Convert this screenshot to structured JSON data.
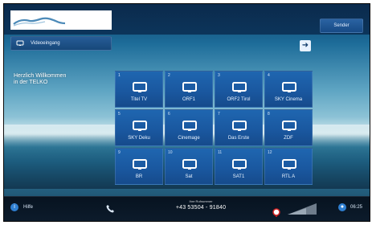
{
  "top_bar": {
    "button_label": "Sender"
  },
  "input_bar": {
    "label": "Videoeingang"
  },
  "welcome": {
    "line1": "Herzlich Willkommen",
    "line2": "in der TELKO"
  },
  "channels": [
    {
      "number": "1",
      "name": "Titel TV"
    },
    {
      "number": "2",
      "name": "ORF1"
    },
    {
      "number": "3",
      "name": "ORF2 Tirol"
    },
    {
      "number": "4",
      "name": "SKY Cinema"
    },
    {
      "number": "5",
      "name": "SKY Deku"
    },
    {
      "number": "6",
      "name": "Cinemage"
    },
    {
      "number": "7",
      "name": "Das Erste"
    },
    {
      "number": "8",
      "name": "ZDF"
    },
    {
      "number": "9",
      "name": "BR"
    },
    {
      "number": "10",
      "name": "Sat"
    },
    {
      "number": "11",
      "name": "SAT1"
    },
    {
      "number": "12",
      "name": "RTL A"
    }
  ],
  "bottom_bar": {
    "help_label": "Hilfe",
    "hotline_title": "Ihre Rufnummer",
    "hotline_number": "+43 53504 - 91840",
    "time": "06:25"
  },
  "colors": {
    "tile_blue": "#1a58a0",
    "bar_dark": "#0c1b2b",
    "accent": "#2f7fd1"
  }
}
